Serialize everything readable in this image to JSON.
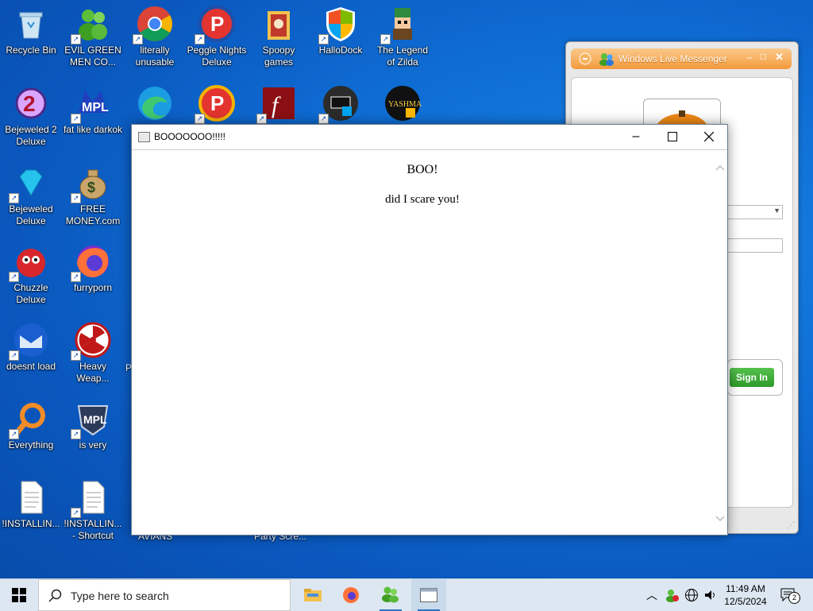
{
  "desktop": {
    "icons": [
      {
        "label": "Recycle Bin",
        "icon": "recycle-bin-icon"
      },
      {
        "label": "EVIL GREEN\nMEN CO...",
        "icon": "messenger-buddies-icon"
      },
      {
        "label": "literally\nunusable",
        "icon": "chrome-icon"
      },
      {
        "label": "Peggle Nights\nDeluxe",
        "icon": "peggle-icon"
      },
      {
        "label": "Spoopy\ngames",
        "icon": "folder-icon"
      },
      {
        "label": "HalloDock",
        "icon": "shield-icon"
      },
      {
        "label": "The Legend\nof Zilda",
        "icon": "zelda-character-icon"
      },
      {
        "label": "Bejeweled 2\nDeluxe",
        "icon": "bejeweled2-icon"
      },
      {
        "label": "fat like darkok",
        "icon": "mpl-logo-icon"
      },
      {
        "label": "",
        "icon": "edge-icon"
      },
      {
        "label": "",
        "icon": "peggle-icon"
      },
      {
        "label": "",
        "icon": "flash-icon"
      },
      {
        "label": "",
        "icon": "dark-app-icon"
      },
      {
        "label": "",
        "icon": "yashma-icon"
      },
      {
        "label": "Bejeweled\nDeluxe",
        "icon": "diamond-icon"
      },
      {
        "label": "FREE\nMONEY.com",
        "icon": "money-bag-icon"
      },
      {
        "label": "Chuzzle\nDeluxe",
        "icon": "chuzzle-icon"
      },
      {
        "label": "furryporn",
        "icon": "firefox-icon"
      },
      {
        "label": "doesnt load",
        "icon": "thunderbird-icon"
      },
      {
        "label": "Heavy\nWeap...",
        "icon": "radiation-icon"
      },
      {
        "label": "Everything",
        "icon": "search-magnifier-icon"
      },
      {
        "label": "is very",
        "icon": "mpl-badge-icon"
      },
      {
        "label": "!INSTALLIN...",
        "icon": "document-icon"
      },
      {
        "label": "!INSTALLIN...\n- Shortcut",
        "icon": "document-shortcut-icon"
      }
    ],
    "partial_labels": {
      "p": "P",
      "avians": "AVIANS",
      "party": "Party Scre..."
    }
  },
  "messenger": {
    "title": "Windows Live Messenger",
    "sign_in": "Sign In"
  },
  "dialog": {
    "title": "BOOOOOOO!!!!!",
    "heading": "BOO!",
    "message": "did I scare you!"
  },
  "taskbar": {
    "search_placeholder": "Type here to search",
    "time": "11:49 AM",
    "date": "12/5/2024",
    "notification_count": "2"
  }
}
